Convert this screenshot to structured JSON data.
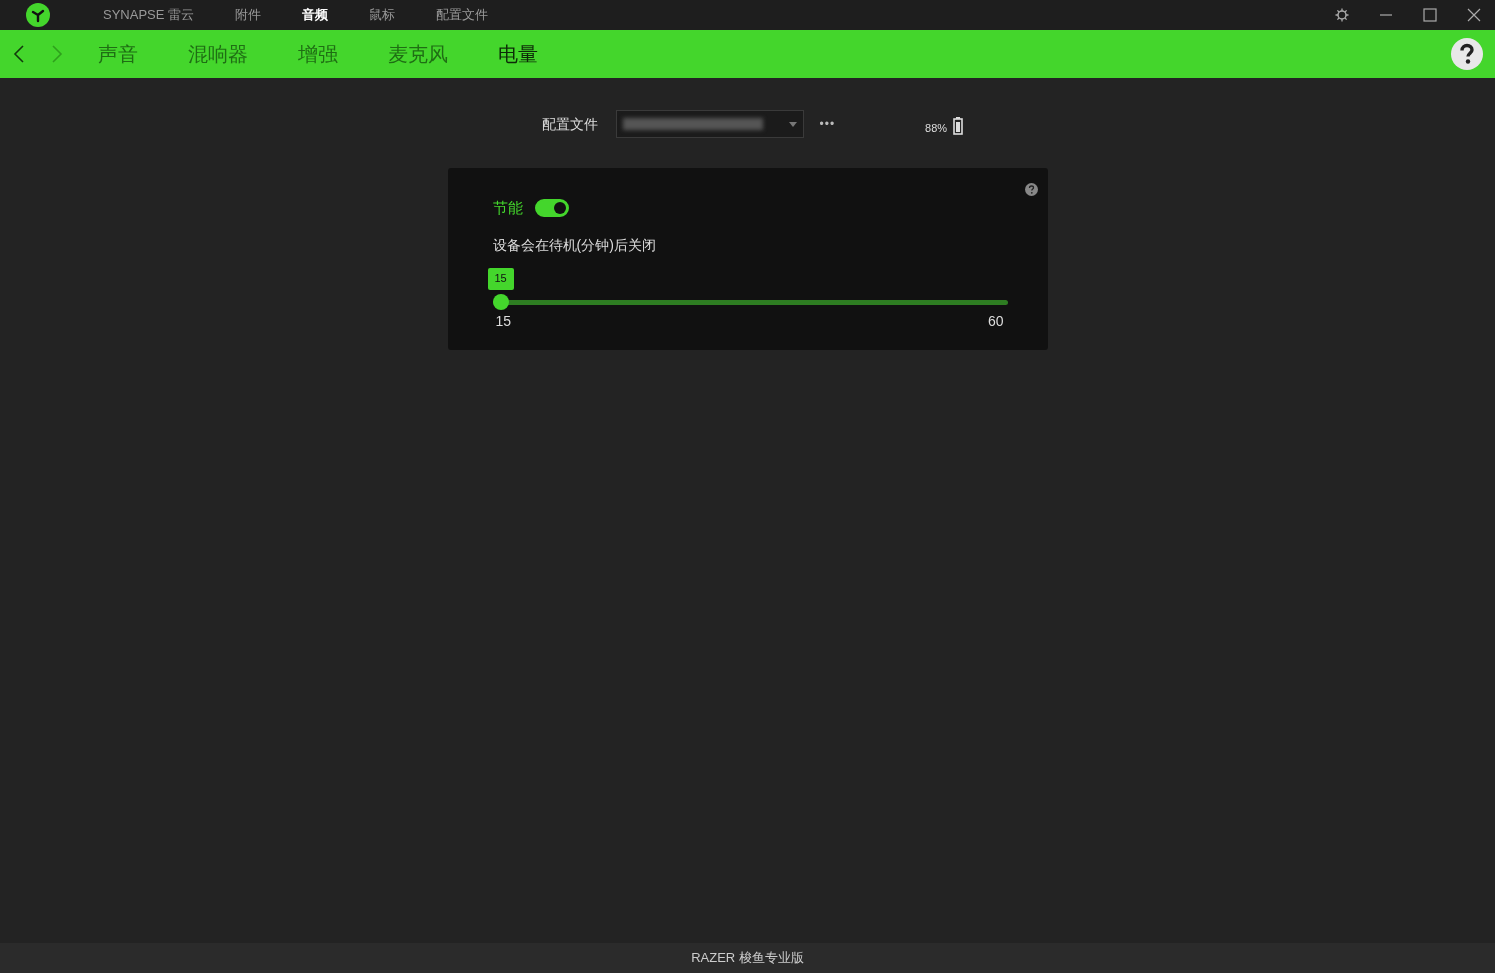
{
  "title_bar": {
    "tabs": [
      {
        "label": "SYNAPSE 雷云",
        "selected": false
      },
      {
        "label": "附件",
        "selected": false
      },
      {
        "label": "音频",
        "selected": true
      },
      {
        "label": "鼠标",
        "selected": false
      },
      {
        "label": "配置文件",
        "selected": false
      }
    ]
  },
  "sub_nav": {
    "back_disabled": false,
    "forward_disabled": true,
    "tabs": [
      {
        "label": "声音",
        "selected": false
      },
      {
        "label": "混响器",
        "selected": false
      },
      {
        "label": "增强",
        "selected": false
      },
      {
        "label": "麦克风",
        "selected": false
      },
      {
        "label": "电量",
        "selected": true
      }
    ]
  },
  "profile": {
    "label": "配置文件",
    "more": "•••"
  },
  "battery": {
    "reading": "88%"
  },
  "power_card": {
    "toggle_label": "节能",
    "on": true,
    "description": "设备会在待机(分钟)后关闭",
    "slider": {
      "value": "15",
      "level": 0,
      "min": "15",
      "max": "60"
    }
  },
  "status_bar": {
    "device": "RAZER 梭鱼专业版"
  }
}
